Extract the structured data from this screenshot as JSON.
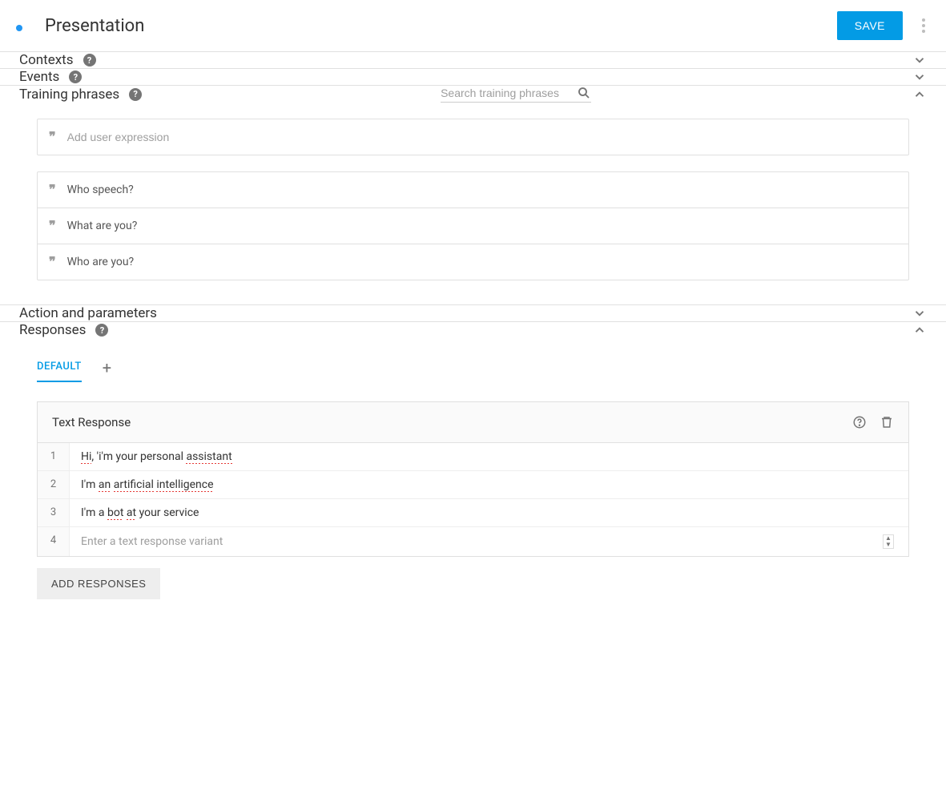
{
  "header": {
    "title": "Presentation",
    "save_label": "SAVE"
  },
  "sections": {
    "contexts": {
      "title": "Contexts"
    },
    "events": {
      "title": "Events"
    },
    "training": {
      "title": "Training phrases",
      "search_placeholder": "Search training phrases",
      "add_placeholder": "Add user expression",
      "phrases": [
        "Who speech?",
        "What are you?",
        "Who are you?"
      ]
    },
    "action": {
      "title": "Action and parameters"
    },
    "responses": {
      "title": "Responses",
      "tabs": {
        "default_label": "DEFAULT"
      },
      "card_title": "Text Response",
      "rows": [
        {
          "n": "1",
          "plain": false
        },
        {
          "n": "2",
          "plain": false
        },
        {
          "n": "3",
          "plain": false
        },
        {
          "n": "4",
          "placeholder": "Enter a text response variant"
        }
      ],
      "row1_pre": "Hi",
      "row1_mid": ", 'i'm your personal ",
      "row1_end": "assistant",
      "row2_pre": "I'm ",
      "row2_w1": "an",
      "row2_sp": " ",
      "row2_w2": "artificial",
      "row2_w3": "intelligence",
      "row3_pre": "I'm a ",
      "row3_w1": "bot",
      "row3_sp": " ",
      "row3_w2": "at",
      "row3_end": " your service",
      "add_responses_label": "ADD RESPONSES"
    }
  }
}
